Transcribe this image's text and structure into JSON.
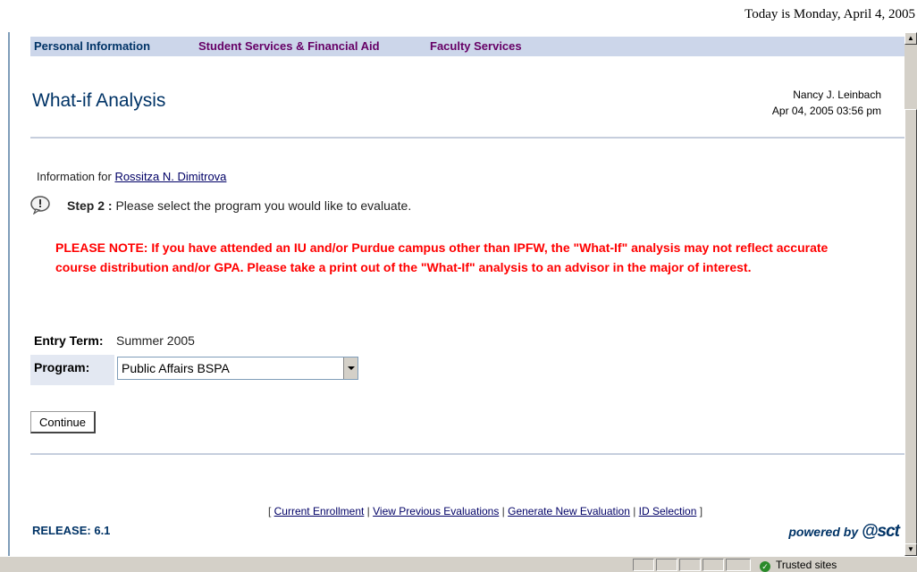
{
  "header": {
    "date_text": "Today is Monday, April 4, 2005"
  },
  "nav": {
    "personal_info": "Personal Information",
    "student_services": "Student Services & Financial Aid",
    "faculty_services": "Faculty Services"
  },
  "page": {
    "title": "What-if Analysis",
    "user_name": "Nancy J. Leinbach",
    "timestamp": "Apr 04, 2005 03:56 pm"
  },
  "info": {
    "prefix": "Information for ",
    "student_name": "Rossitza N. Dimitrova"
  },
  "step": {
    "label": "Step 2 :",
    "text": " Please select the program you would like to evaluate."
  },
  "note": "PLEASE NOTE: If you have attended an IU and/or Purdue campus other than IPFW, the \"What-If\" analysis may not reflect accurate course distribution and/or GPA. Please take a print out of the \"What-If\" analysis to an advisor in the major of interest.",
  "form": {
    "entry_term_label": "Entry Term:",
    "entry_term_value": "Summer 2005",
    "program_label": "Program:",
    "program_value": "Public Affairs BSPA",
    "continue_label": "Continue"
  },
  "footer": {
    "open_bracket": "[ ",
    "sep": " | ",
    "close_bracket": " ]",
    "links": [
      "Current Enrollment",
      "View Previous Evaluations",
      "Generate New Evaluation",
      "ID Selection"
    ],
    "release": "RELEASE: 6.1",
    "powered_by": "powered by",
    "logo_text": "sct"
  },
  "statusbar": {
    "zone": "Trusted sites"
  }
}
